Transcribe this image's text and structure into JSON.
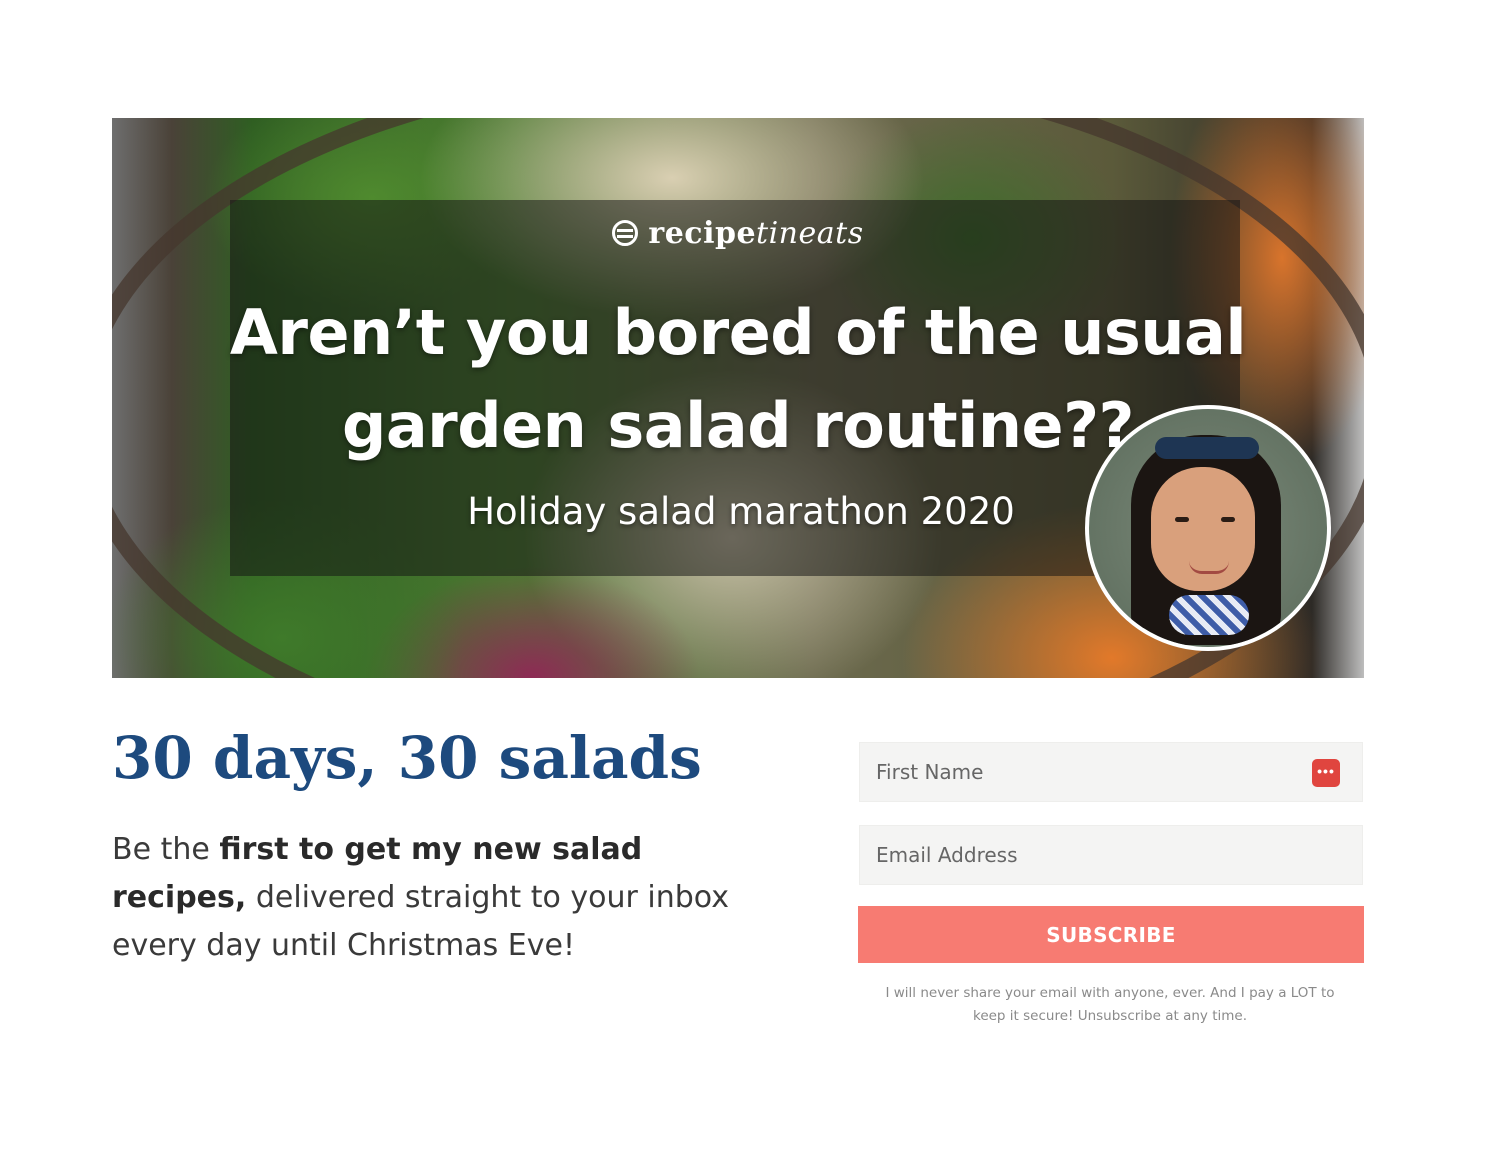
{
  "hero": {
    "logo_prefix": "recipe",
    "logo_suffix": "tineats",
    "headline_line1": "Aren’t you bored of the usual",
    "headline_line2": "garden salad routine??",
    "subheadline": "Holiday salad marathon 2020"
  },
  "promo": {
    "title": "30 days, 30 salads",
    "body_lead": "Be the ",
    "body_bold": "first to get my new salad recipes,",
    "body_rest": " delivered straight to your inbox every day until Christmas Eve!"
  },
  "form": {
    "first_name_placeholder": "First Name",
    "email_placeholder": "Email Address",
    "autofill_icon_glyph": "•••",
    "subscribe_label": "SUBSCRIBE",
    "disclaimer": "I will never share your email with anyone, ever. And I pay a LOT to keep it secure! Unsubscribe at any time."
  },
  "icons": {
    "logo": "recipetineats-logo-icon",
    "autofill": "password-manager-autofill-icon"
  },
  "colors": {
    "title_blue": "#1d4a7e",
    "subscribe_button": "#f77b72",
    "autofill_icon": "#e0453f"
  }
}
